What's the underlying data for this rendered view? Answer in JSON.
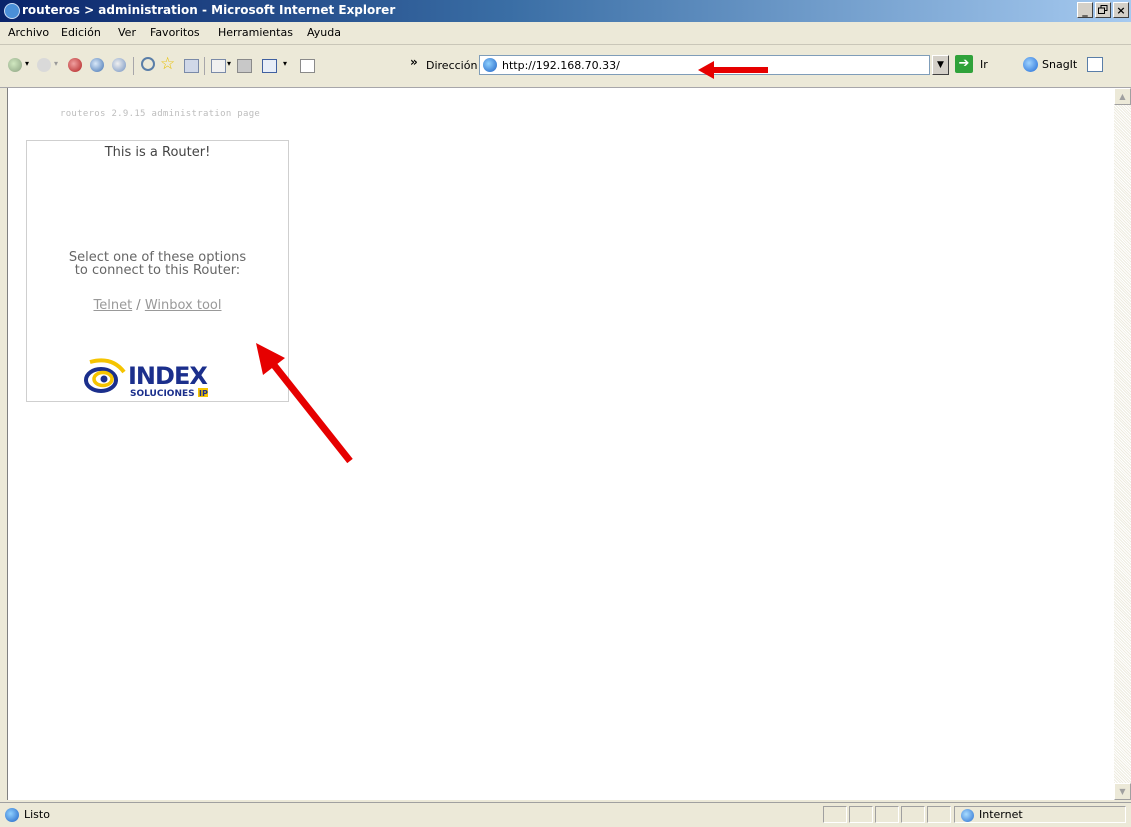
{
  "window": {
    "title": "routeros > administration - Microsoft Internet Explorer",
    "buttons": [
      "_",
      "Б",
      "×"
    ]
  },
  "menu": [
    "Archivo",
    "Edición",
    "Ver",
    "Favoritos",
    "Herramientas",
    "Ayuda"
  ],
  "toolbar": {
    "chevron": "»",
    "address_label": "Dirección",
    "address_value": "http://192.168.70.33/",
    "go_label": "Ir",
    "snagit_label": "SnagIt"
  },
  "page": {
    "admin_title": "routeros 2.9.15 administration page",
    "router_title": "This is a Router!",
    "select_line1": "Select one of these options",
    "select_line2": "to connect to this Router:",
    "link_telnet": "Telnet",
    "link_separator": " / ",
    "link_winbox": "Winbox tool",
    "logo_text": "INDEX",
    "logo_sub": "SOLUCIONES IP"
  },
  "status": {
    "text": "Listo",
    "zone": "Internet"
  },
  "colors": {
    "annotation_arrow": "#e60000",
    "logo_blue": "#1b2f8c",
    "logo_yellow": "#f5c400"
  }
}
